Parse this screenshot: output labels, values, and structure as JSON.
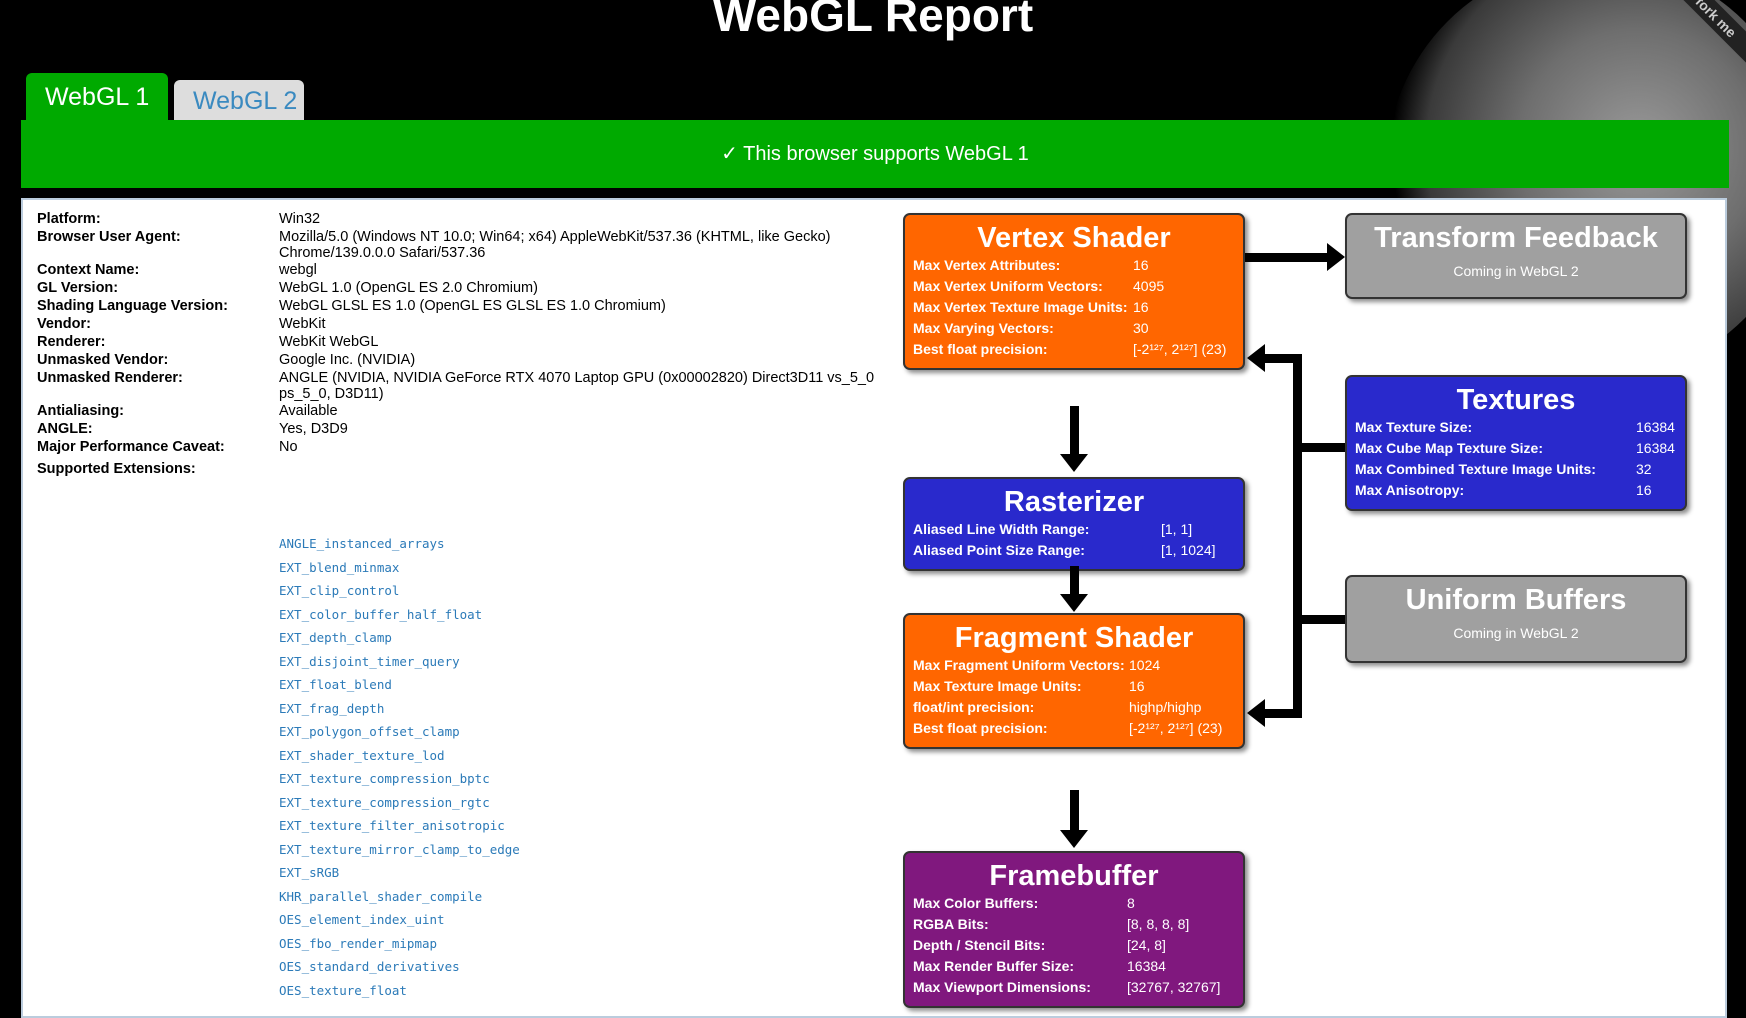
{
  "page": {
    "title": "WebGL Report",
    "ribbon": "fork me"
  },
  "tabs": [
    {
      "label": "WebGL 1"
    },
    {
      "label": "WebGL 2"
    }
  ],
  "banner": "✓ This browser supports WebGL 1",
  "info": [
    {
      "k": "Platform:",
      "v": "Win32"
    },
    {
      "k": "Browser User Agent:",
      "v": "Mozilla/5.0 (Windows NT 10.0; Win64; x64) AppleWebKit/537.36 (KHTML, like Gecko) Chrome/139.0.0.0 Safari/537.36"
    },
    {
      "k": "Context Name:",
      "v": "webgl"
    },
    {
      "k": "GL Version:",
      "v": "WebGL 1.0 (OpenGL ES 2.0 Chromium)"
    },
    {
      "k": "Shading Language Version:",
      "v": "WebGL GLSL ES 1.0 (OpenGL ES GLSL ES 1.0 Chromium)"
    },
    {
      "k": "Vendor:",
      "v": "WebKit"
    },
    {
      "k": "Renderer:",
      "v": "WebKit WebGL"
    },
    {
      "k": "Unmasked Vendor:",
      "v": "Google Inc. (NVIDIA)"
    },
    {
      "k": "Unmasked Renderer:",
      "v": "ANGLE (NVIDIA, NVIDIA GeForce RTX 4070 Laptop GPU (0x00002820) Direct3D11 vs_5_0 ps_5_0, D3D11)"
    },
    {
      "k": "Antialiasing:",
      "v": "Available"
    },
    {
      "k": "ANGLE:",
      "v": "Yes, D3D9"
    },
    {
      "k": "Major Performance Caveat:",
      "v": "No"
    },
    {
      "k": "Supported Extensions:",
      "v": ""
    }
  ],
  "extensions": [
    "ANGLE_instanced_arrays",
    "EXT_blend_minmax",
    "EXT_clip_control",
    "EXT_color_buffer_half_float",
    "EXT_depth_clamp",
    "EXT_disjoint_timer_query",
    "EXT_float_blend",
    "EXT_frag_depth",
    "EXT_polygon_offset_clamp",
    "EXT_shader_texture_lod",
    "EXT_texture_compression_bptc",
    "EXT_texture_compression_rgtc",
    "EXT_texture_filter_anisotropic",
    "EXT_texture_mirror_clamp_to_edge",
    "EXT_sRGB",
    "KHR_parallel_shader_compile",
    "OES_element_index_uint",
    "OES_fbo_render_mipmap",
    "OES_standard_derivatives",
    "OES_texture_float"
  ],
  "vertex": {
    "title": "Vertex Shader",
    "rows": [
      {
        "k": "Max Vertex Attributes:",
        "v": "16"
      },
      {
        "k": "Max Vertex Uniform Vectors:",
        "v": "4095"
      },
      {
        "k": "Max Vertex Texture Image Units:",
        "v": "16"
      },
      {
        "k": "Max Varying Vectors:",
        "v": "30"
      },
      {
        "k": "Best float precision:",
        "v": "[-2¹²⁷, 2¹²⁷] (23)"
      }
    ]
  },
  "rasterizer": {
    "title": "Rasterizer",
    "rows": [
      {
        "k": "Aliased Line Width Range:",
        "v": "[1, 1]"
      },
      {
        "k": "Aliased Point Size Range:",
        "v": "[1, 1024]"
      }
    ]
  },
  "fragment": {
    "title": "Fragment Shader",
    "rows": [
      {
        "k": "Max Fragment Uniform Vectors:",
        "v": "1024"
      },
      {
        "k": "Max Texture Image Units:",
        "v": "16"
      },
      {
        "k": "float/int precision:",
        "v": "highp/highp"
      },
      {
        "k": "Best float precision:",
        "v": "[-2¹²⁷, 2¹²⁷] (23)"
      }
    ]
  },
  "framebuffer": {
    "title": "Framebuffer",
    "rows": [
      {
        "k": "Max Color Buffers:",
        "v": "8"
      },
      {
        "k": "RGBA Bits:",
        "v": "[8, 8, 8, 8]"
      },
      {
        "k": "Depth / Stencil Bits:",
        "v": "[24, 8]"
      },
      {
        "k": "Max Render Buffer Size:",
        "v": "16384"
      },
      {
        "k": "Max Viewport Dimensions:",
        "v": "[32767, 32767]"
      }
    ]
  },
  "transform": {
    "title": "Transform Feedback",
    "sub": "Coming in WebGL 2"
  },
  "textures": {
    "title": "Textures",
    "rows": [
      {
        "k": "Max Texture Size:",
        "v": "16384"
      },
      {
        "k": "Max Cube Map Texture Size:",
        "v": "16384"
      },
      {
        "k": "Max Combined Texture Image Units:",
        "v": "32"
      },
      {
        "k": "Max Anisotropy:",
        "v": "16"
      }
    ]
  },
  "uniform": {
    "title": "Uniform Buffers",
    "sub": "Coming in WebGL 2"
  },
  "colors": {
    "green": "#00aa00",
    "orange": "#ff6600",
    "blue": "#2929cc",
    "purple": "#80187e",
    "gray": "#a0a0a0",
    "link": "#2b7ab8"
  }
}
